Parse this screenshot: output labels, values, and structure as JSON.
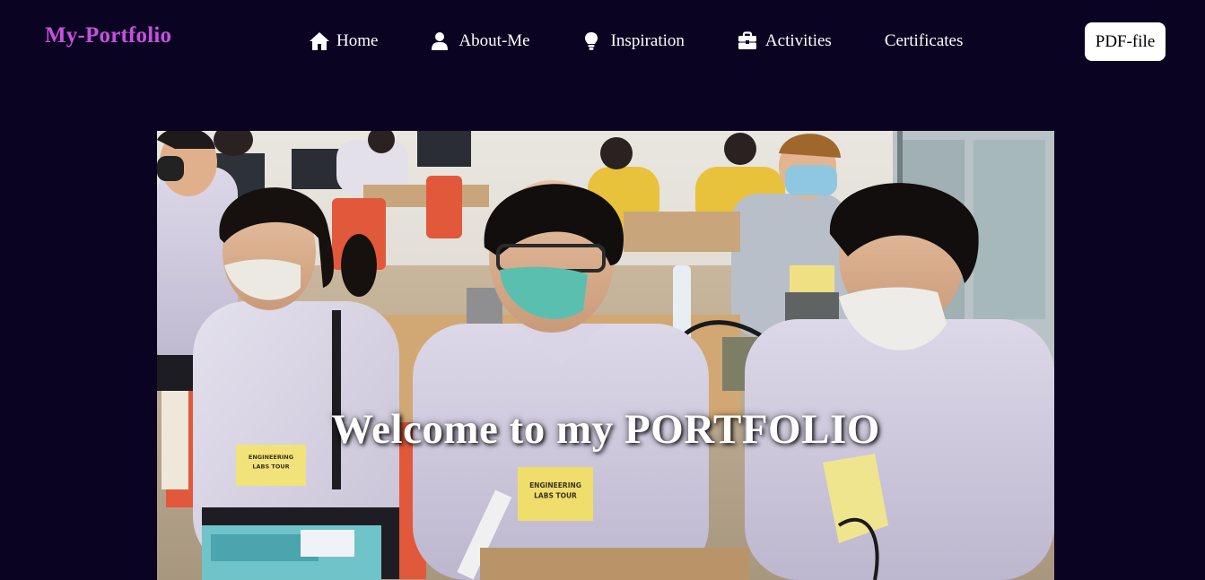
{
  "navbar": {
    "brand": "My-Portfolio",
    "items": [
      {
        "label": "Home",
        "icon": "home-icon"
      },
      {
        "label": "About-Me",
        "icon": "user-icon"
      },
      {
        "label": "Inspiration",
        "icon": "lightbulb-icon"
      },
      {
        "label": "Activities",
        "icon": "briefcase-icon"
      },
      {
        "label": "Certificates",
        "icon": ""
      }
    ],
    "pdf_button": "PDF-file"
  },
  "hero": {
    "title": "Welcome to my PORTFOLIO",
    "badge_line1": "ENGINEERING",
    "badge_line2": "LABS TOUR"
  },
  "colors": {
    "background": "#0b0322",
    "brand": "#c94fe0",
    "nav_text": "#ffffff",
    "button_bg": "#ffffff"
  }
}
